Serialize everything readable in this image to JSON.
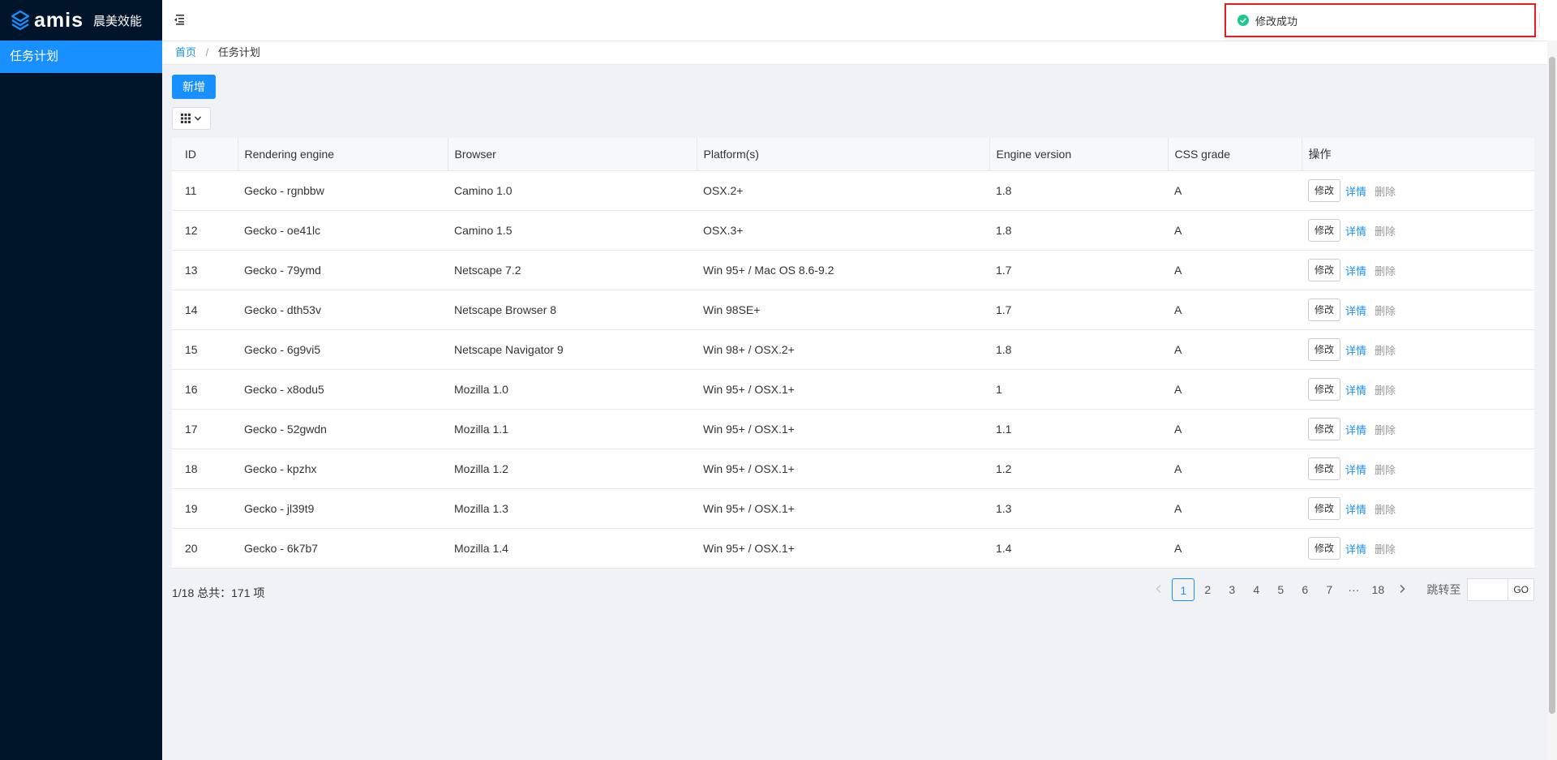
{
  "brand": {
    "logo_icon": "amis-logo-icon",
    "name": "amis",
    "subtitle": "晨美效能"
  },
  "sidebar": {
    "items": [
      {
        "label": "任务计划",
        "active": true
      }
    ]
  },
  "header": {
    "menu_icon": "menu-fold-icon"
  },
  "breadcrumb": {
    "home": "首页",
    "separator": "/",
    "current": "任务计划"
  },
  "toolbar": {
    "add_label": "新增",
    "columns_icon": "grid-icon"
  },
  "table": {
    "columns": [
      "ID",
      "Rendering engine",
      "Browser",
      "Platform(s)",
      "Engine version",
      "CSS grade",
      "操作"
    ],
    "rows": [
      [
        "11",
        "Gecko - rgnbbw",
        "Camino 1.0",
        "OSX.2+",
        "1.8",
        "A"
      ],
      [
        "12",
        "Gecko - oe41lc",
        "Camino 1.5",
        "OSX.3+",
        "1.8",
        "A"
      ],
      [
        "13",
        "Gecko - 79ymd",
        "Netscape 7.2",
        "Win 95+ / Mac OS 8.6-9.2",
        "1.7",
        "A"
      ],
      [
        "14",
        "Gecko - dth53v",
        "Netscape Browser 8",
        "Win 98SE+",
        "1.7",
        "A"
      ],
      [
        "15",
        "Gecko - 6g9vi5",
        "Netscape Navigator 9",
        "Win 98+ / OSX.2+",
        "1.8",
        "A"
      ],
      [
        "16",
        "Gecko - x8odu5",
        "Mozilla 1.0",
        "Win 95+ / OSX.1+",
        "1",
        "A"
      ],
      [
        "17",
        "Gecko - 52gwdn",
        "Mozilla 1.1",
        "Win 95+ / OSX.1+",
        "1.1",
        "A"
      ],
      [
        "18",
        "Gecko - kpzhx",
        "Mozilla 1.2",
        "Win 95+ / OSX.1+",
        "1.2",
        "A"
      ],
      [
        "19",
        "Gecko - jl39t9",
        "Mozilla 1.3",
        "Win 95+ / OSX.1+",
        "1.3",
        "A"
      ],
      [
        "20",
        "Gecko - 6k7b7",
        "Mozilla 1.4",
        "Win 95+ / OSX.1+",
        "1.4",
        "A"
      ]
    ],
    "actions": {
      "edit": "修改",
      "detail": "详情",
      "delete": "删除"
    }
  },
  "pagination": {
    "summary": "1/18 总共：171 项",
    "pages": [
      "1",
      "2",
      "3",
      "4",
      "5",
      "6",
      "7",
      "···",
      "18"
    ],
    "current": "1",
    "prev_icon": "chevron-left-icon",
    "next_icon": "chevron-right-icon",
    "jump_label": "跳转至",
    "jump_value": "",
    "go_label": "GO"
  },
  "toast": {
    "icon": "check-circle-icon",
    "message": "修改成功",
    "color": "#1cc88a"
  },
  "colors": {
    "primary": "#1890ff",
    "sidebar_bg": "#001529",
    "highlight_border": "#e02020"
  }
}
